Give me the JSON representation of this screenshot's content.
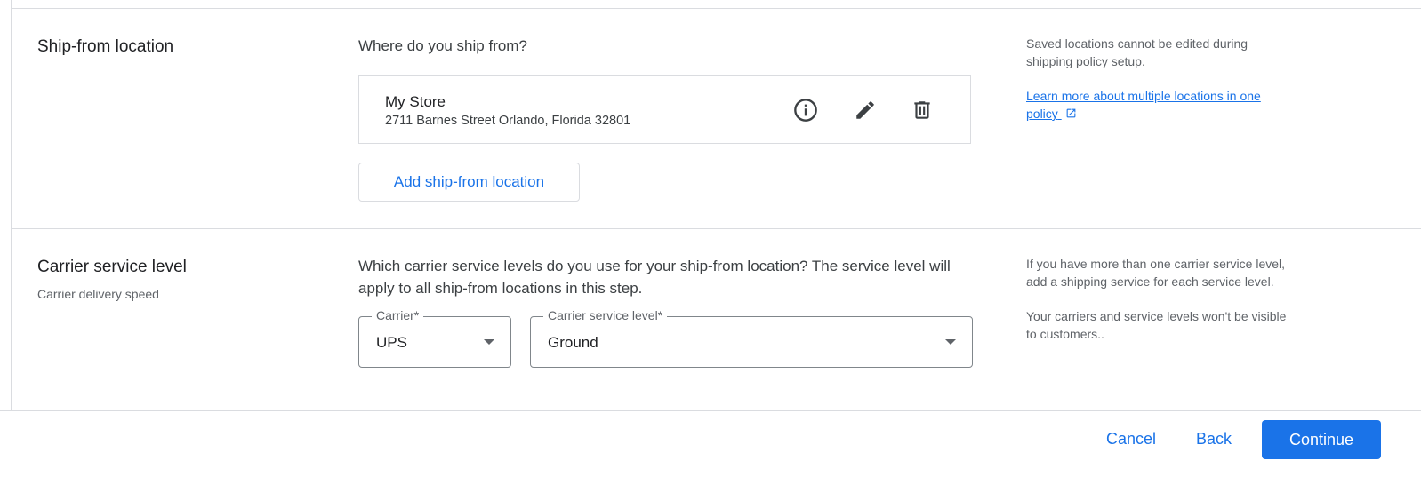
{
  "ship_from": {
    "title": "Ship-from location",
    "question": "Where do you ship from?",
    "location": {
      "name": "My Store",
      "address": "2711 Barnes Street Orlando, Florida 32801",
      "icons": [
        "info-icon",
        "edit-icon",
        "delete-icon"
      ]
    },
    "add_button": "Add ship-from location",
    "help_text": "Saved locations cannot be edited during shipping policy setup.",
    "help_link_line1": "Learn more about multiple locations in one",
    "help_link_line2": "policy"
  },
  "carrier": {
    "title": "Carrier service level",
    "subtitle": "Carrier delivery speed",
    "question": "Which carrier service levels do you use for your ship-from location? The service level will apply to all ship-from locations in this step.",
    "carrier_select": {
      "label": "Carrier*",
      "value": "UPS"
    },
    "service_select": {
      "label": "Carrier service level*",
      "value": "Ground"
    },
    "help_text_1": "If you have more than one carrier service level, add a shipping service for each service level.",
    "help_text_2": "Your carriers and service levels won't be visible to customers.."
  },
  "footer": {
    "cancel": "Cancel",
    "back": "Back",
    "continue": "Continue"
  },
  "colors": {
    "accent": "#1a73e8",
    "border": "#dadce0"
  }
}
